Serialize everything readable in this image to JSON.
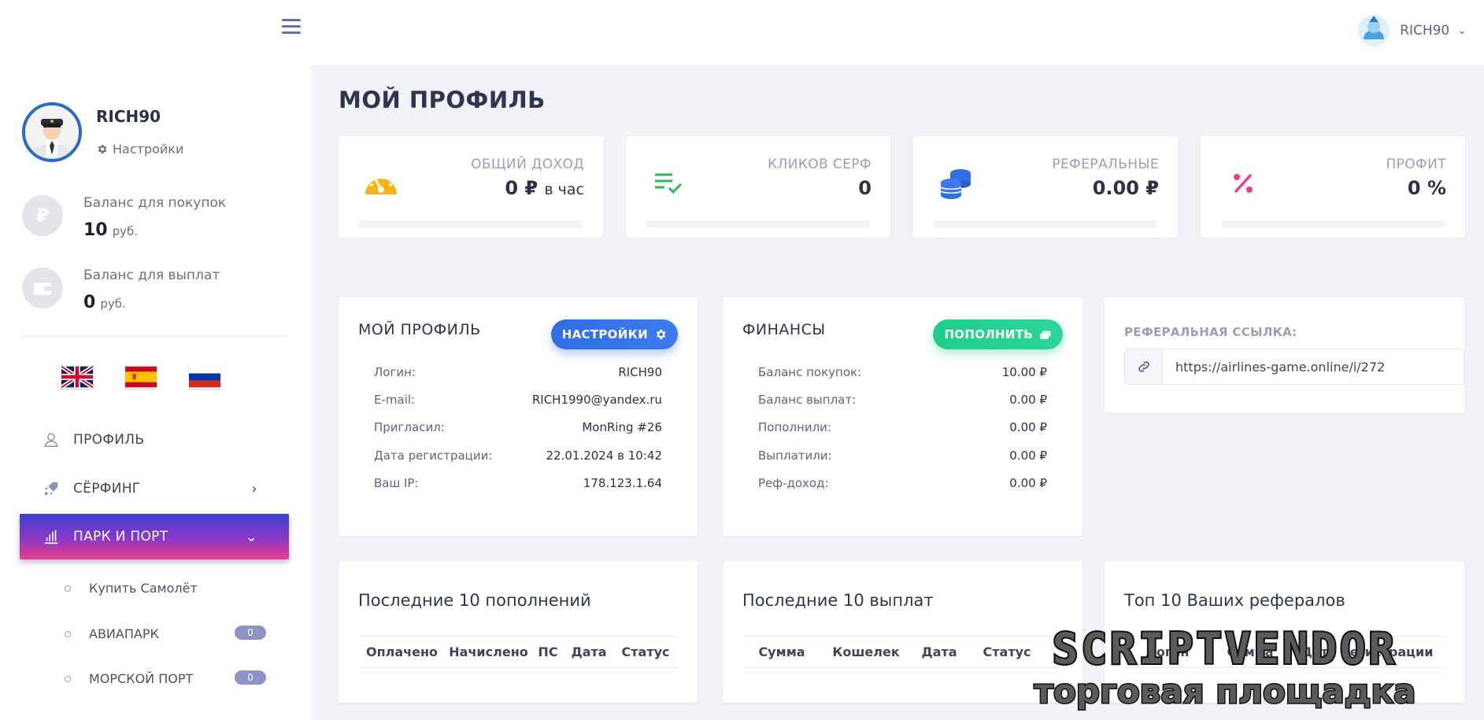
{
  "sidebar": {
    "user": {
      "name": "RICH90",
      "settings_label": "Настройки"
    },
    "balances": [
      {
        "label": "Баланс для покупок",
        "value": "10",
        "unit": "руб.",
        "icon": "ruble-icon"
      },
      {
        "label": "Баланс для выплат",
        "value": "0",
        "unit": "руб.",
        "icon": "wallet-icon"
      }
    ],
    "flags": [
      "uk-flag",
      "spain-flag",
      "russia-flag"
    ],
    "nav": {
      "profile": "ПРОФИЛЬ",
      "surfing": "СЁРФИНГ",
      "park": "ПАРК И ПОРТ"
    },
    "sub": [
      {
        "label": "Купить Самолёт"
      },
      {
        "label": "АВИАПАРК",
        "badge": "0"
      },
      {
        "label": "МОРСКОЙ ПОРТ",
        "badge": "0"
      }
    ]
  },
  "topbar": {
    "username": "RICH90"
  },
  "page": {
    "title": "МОЙ ПРОФИЛЬ"
  },
  "stats": [
    {
      "label": "ОБЩИЙ ДОХОД",
      "value": "0 ₽",
      "suffix": "в час",
      "icon": "gauge-icon",
      "color": "#f9b115"
    },
    {
      "label": "КЛИКОВ СЕРФ",
      "value": "0",
      "suffix": "",
      "icon": "checklist-icon",
      "color": "#2eb85c"
    },
    {
      "label": "РЕФЕРАЛЬНЫЕ",
      "value": "0.00 ₽",
      "suffix": "",
      "icon": "coins-icon",
      "color": "#2f6ee3"
    },
    {
      "label": "ПРОФИТ",
      "value": "0 %",
      "suffix": "",
      "icon": "percent-icon",
      "color": "#ec3c8c"
    }
  ],
  "profile_card": {
    "title": "МОЙ ПРОФИЛЬ",
    "button": "НАСТРОЙКИ",
    "rows": [
      {
        "k": "Логин:",
        "v": "RICH90"
      },
      {
        "k": "E-mail:",
        "v": "RICH1990@yandex.ru"
      },
      {
        "k": "Пригласил:",
        "v": "MonRing #26"
      },
      {
        "k": "Дата регистрации:",
        "v": "22.01.2024 в 10:42"
      },
      {
        "k": "Ваш IP:",
        "v": "178.123.1.64"
      }
    ]
  },
  "finance_card": {
    "title": "ФИНАНСЫ",
    "button": "ПОПОЛНИТЬ",
    "rows": [
      {
        "k": "Баланс покупок:",
        "v": "10.00 ₽"
      },
      {
        "k": "Баланс выплат:",
        "v": "0.00 ₽"
      },
      {
        "k": "Пополнили:",
        "v": "0.00 ₽"
      },
      {
        "k": "Выплатили:",
        "v": "0.00 ₽"
      },
      {
        "k": "Реф-доход:",
        "v": "0.00 ₽"
      }
    ]
  },
  "ref_card": {
    "label": "РЕФЕРАЛЬНАЯ ССЫЛКА:",
    "link": "https://airlines-game.online/i/272"
  },
  "deposits_table": {
    "title": "Последние 10 пополнений",
    "columns": [
      "Оплачено",
      "Начислено",
      "ПС",
      "Дата",
      "Статус"
    ]
  },
  "payouts_table": {
    "title": "Последние 10 выплат",
    "columns": [
      "Сумма",
      "Кошелек",
      "Дата",
      "Статус"
    ]
  },
  "referrals_table": {
    "title": "Топ 10 Ваших рефералов",
    "columns": [
      "Логин",
      "Сумма",
      "Дата регистрации"
    ]
  },
  "watermark": {
    "line1": "SCRIPTVENDOR",
    "line2": "торговая площадка"
  }
}
